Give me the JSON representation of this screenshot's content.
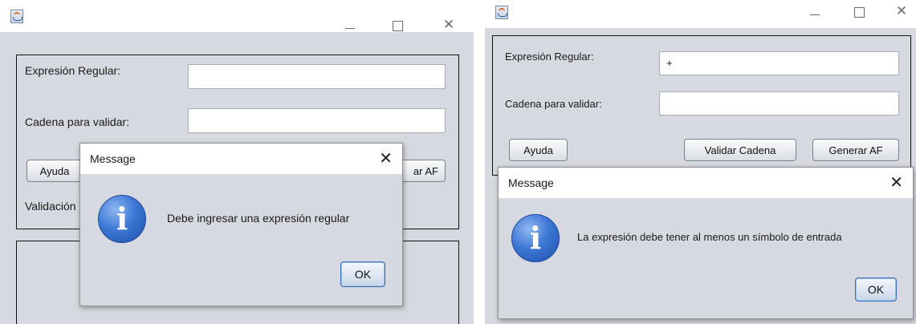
{
  "left_window": {
    "title": "",
    "labels": {
      "regex": "Expresión Regular:",
      "string": "Cadena para validar:",
      "validation": "Validación"
    },
    "inputs": {
      "regex_value": "",
      "string_value": ""
    },
    "buttons": {
      "help": "Ayuda",
      "generate_partial": "ar AF"
    },
    "dialog": {
      "title": "Message",
      "message": "Debe ingresar una expresión regular",
      "ok": "OK"
    }
  },
  "right_window": {
    "title": "",
    "labels": {
      "regex": "Expresión Regular:",
      "string": "Cadena para validar:"
    },
    "inputs": {
      "regex_value": "+",
      "string_value": ""
    },
    "buttons": {
      "help": "Ayuda",
      "validate": "Validar Cadena",
      "generate": "Generar AF"
    },
    "dialog": {
      "title": "Message",
      "message": "La expresión debe tener al menos un símbolo de entrada",
      "ok": "OK"
    }
  },
  "icons": {
    "app": "java-app-icon",
    "minimize": "minimize-icon",
    "maximize": "maximize-icon",
    "close": "close-icon",
    "info": "information-icon"
  }
}
